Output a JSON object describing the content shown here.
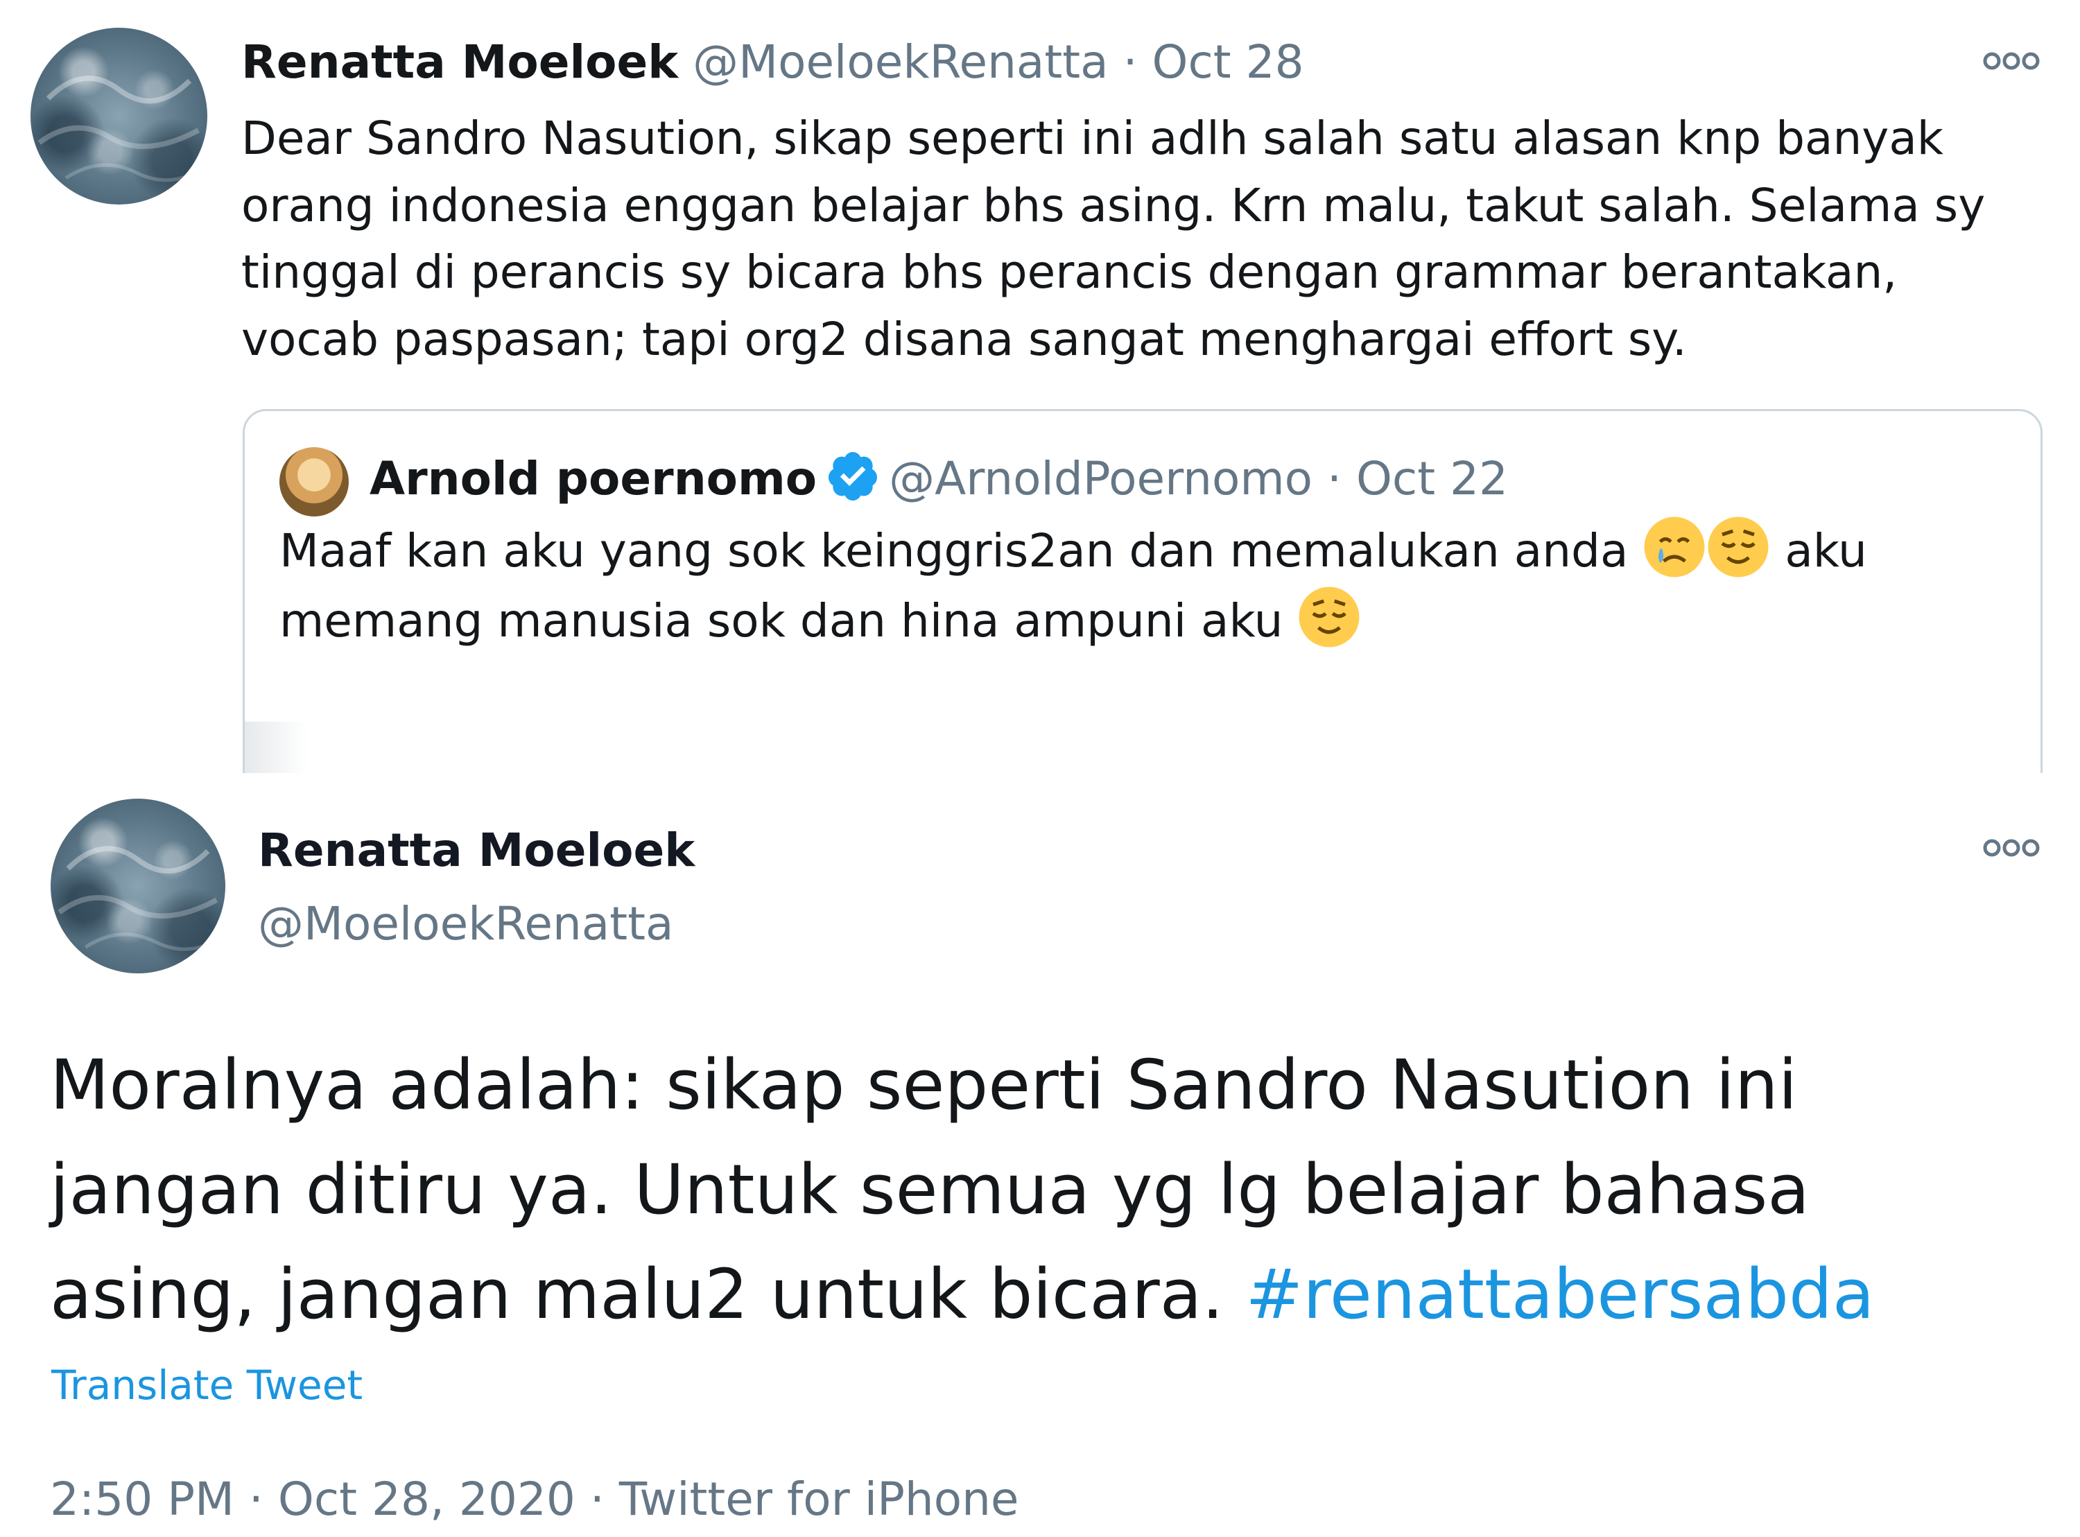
{
  "tweet1": {
    "author_name": "Renatta Moeloek",
    "handle": "@MoeloekRenatta",
    "separator": "·",
    "date": "Oct 28",
    "body_lines": [
      "Dear Sandro Nasution, sikap seperti ini adlh salah satu alasan knp banyak",
      "orang indonesia enggan belajar bhs asing. Krn malu, takut salah. Selama sy",
      "tinggal di perancis sy bicara bhs perancis dengan grammar berantakan,",
      "vocab paspasan; tapi org2 disana sangat menghargai effort sy."
    ],
    "more_icon": "more-horizontal-icon",
    "quoted": {
      "author_name": "Arnold poernomo",
      "verified_icon": "verified-badge-icon",
      "handle": "@ArnoldPoernomo",
      "separator": "·",
      "date": "Oct 22",
      "line1_text": "Maaf kan aku yang sok keinggris2an dan memalukan anda ",
      "line1_after": " aku",
      "line2_text": "memang manusia sok dan hina ampuni aku ",
      "emojis": [
        "crying-face-emoji",
        "relieved-face-emoji",
        "relieved-face-emoji"
      ]
    }
  },
  "tweet2": {
    "author_name": "Renatta Moeloek",
    "handle": "@MoeloekRenatta",
    "more_icon": "more-horizontal-icon",
    "body_line1": "Moralnya adalah: sikap seperti Sandro Nasution ini",
    "body_line2": "jangan ditiru ya. Untuk semua yg lg belajar bahasa",
    "body_line3_text": "asing, jangan malu2 untuk bicara. ",
    "hashtag": "#renattabersabda",
    "translate_label": "Translate Tweet",
    "time": "2:50 PM",
    "separator": "·",
    "date": "Oct 28, 2020",
    "source": "Twitter for iPhone"
  },
  "colors": {
    "text": "#14171a",
    "muted": "#657786",
    "link": "#1b95e0",
    "border": "#ccd6dd",
    "verified": "#1da1f2"
  }
}
